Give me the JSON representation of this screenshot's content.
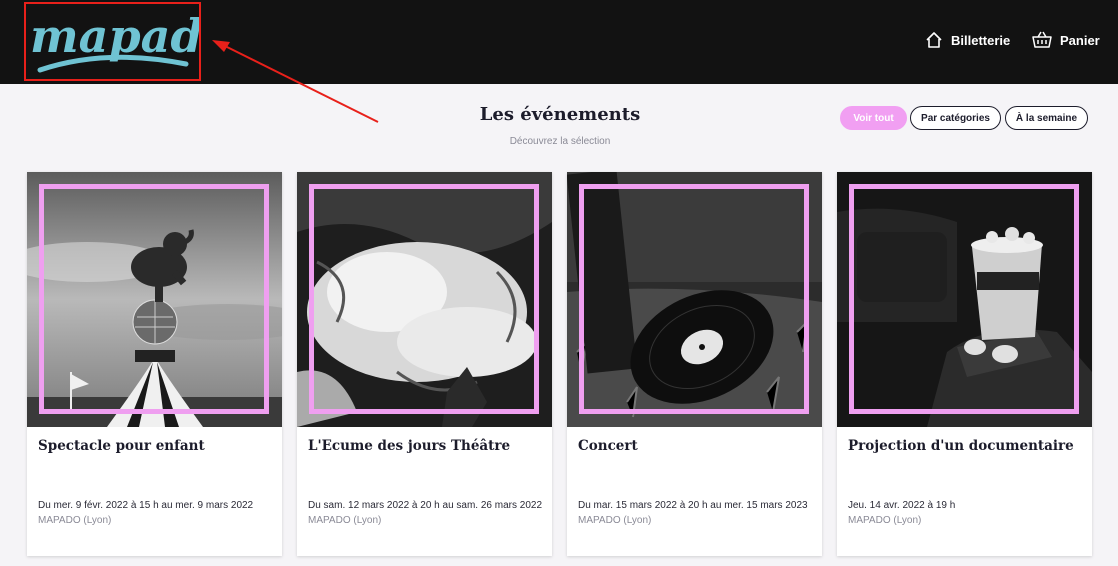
{
  "header": {
    "logo_text": "mapado",
    "nav": [
      {
        "label": "Billetterie",
        "icon": "home-icon"
      },
      {
        "label": "Panier",
        "icon": "basket-icon"
      }
    ]
  },
  "main": {
    "title": "Les événements",
    "subtitle": "Découvrez la sélection",
    "filters": [
      "Voir tout",
      "Par catégories",
      "À la semaine"
    ],
    "active_filter": "Voir tout"
  },
  "events": [
    {
      "title": "Spectacle pour enfant",
      "date": "Du mer. 9 févr. 2022 à 15 h au mer. 9 mars 2022",
      "venue": "MAPADO (Lyon)",
      "image": "circus-elephant-photo"
    },
    {
      "title": "L'Ecume des jours Théâtre",
      "date": "Du sam. 12 mars 2022 à 20 h au sam. 26 mars 2022",
      "venue": "MAPADO (Lyon)",
      "image": "ocean-wave-photo"
    },
    {
      "title": "Concert",
      "date": "Du mar. 15 mars 2022 à 20 h au mer. 15 mars 2023",
      "venue": "MAPADO (Lyon)",
      "image": "vinyl-record-photo"
    },
    {
      "title": "Projection d'un documentaire",
      "date": "Jeu. 14 avr. 2022 à 19 h",
      "venue": "MAPADO (Lyon)",
      "image": "popcorn-cinema-photo"
    }
  ],
  "colors": {
    "header_bg": "#121212",
    "accent_pink": "#f19ff2",
    "annotation_red": "#e8201a",
    "logo_teal": "#6fc3d3"
  }
}
